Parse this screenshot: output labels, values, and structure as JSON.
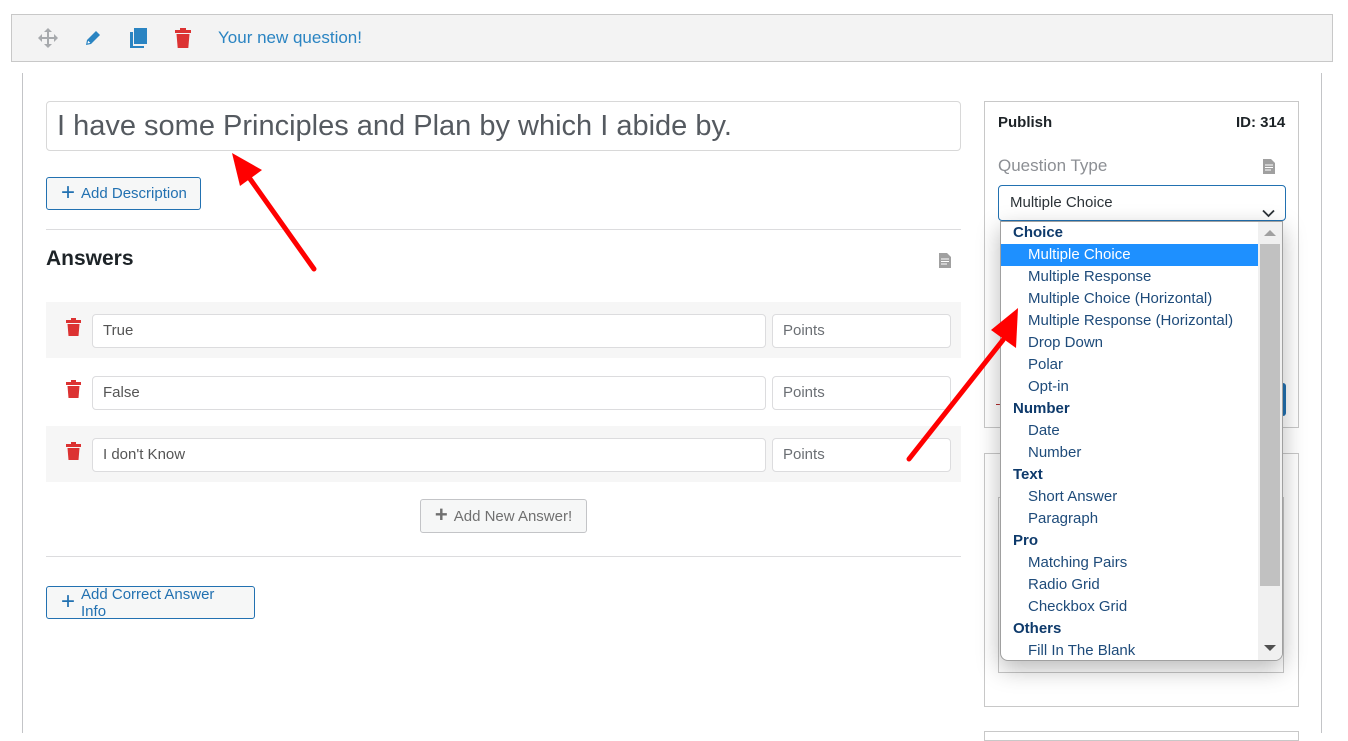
{
  "toolbar": {
    "icons": [
      "move-icon",
      "pencil-icon",
      "copy-icon",
      "trash-icon"
    ],
    "title": "Your new question!",
    "colors": {
      "title": "#2a84c2",
      "move": "#a7aaad",
      "edit": "#2a84c2",
      "copy": "#2a84c2",
      "delete": "#dc3232"
    }
  },
  "question": {
    "text": "I have some Principles and Plan by which I abide by."
  },
  "buttons": {
    "add_description": "Add Description",
    "add_new_answer": "Add New Answer!",
    "add_correct_answer_info": "Add Correct Answer Info"
  },
  "answers": {
    "title": "Answers",
    "rows": [
      {
        "text": "True",
        "points_placeholder": "Points"
      },
      {
        "text": "False",
        "points_placeholder": "Points"
      },
      {
        "text": "I don't Know",
        "points_placeholder": "Points"
      }
    ]
  },
  "sidebar": {
    "publish_label": "Publish",
    "id_label": "ID: 314",
    "question_type_label": "Question Type",
    "selected_type": "Multiple Choice"
  },
  "dropdown": {
    "groups": [
      {
        "label": "Choice",
        "items": [
          "Multiple Choice",
          "Multiple Response",
          "Multiple Choice (Horizontal)",
          "Multiple Response (Horizontal)",
          "Drop Down",
          "Polar",
          "Opt-in"
        ]
      },
      {
        "label": "Number",
        "items": [
          "Date",
          "Number"
        ]
      },
      {
        "label": "Text",
        "items": [
          "Short Answer",
          "Paragraph"
        ]
      },
      {
        "label": "Pro",
        "items": [
          "Matching Pairs",
          "Radio Grid",
          "Checkbox Grid"
        ]
      },
      {
        "label": "Others",
        "items": [
          "Fill In The Blank"
        ]
      }
    ],
    "selected": "Multiple Choice",
    "highlight_color": "#1e90ff"
  },
  "annotations": {
    "arrow_color": "#ff0000",
    "arrows": [
      "arrow-to-question-title",
      "arrow-to-question-type-options"
    ]
  }
}
